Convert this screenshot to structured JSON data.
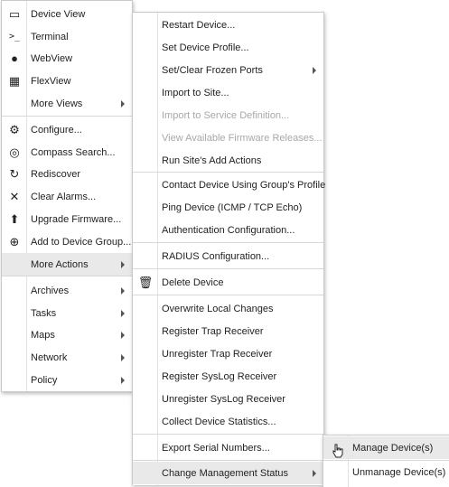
{
  "primary_menu": {
    "items": [
      {
        "label": "Device View",
        "icon": "display-icon",
        "glyph": "▭"
      },
      {
        "label": "Terminal",
        "icon": "terminal-icon",
        "glyph": ">_"
      },
      {
        "label": "WebView",
        "icon": "globe-icon",
        "glyph": "●"
      },
      {
        "label": "FlexView",
        "icon": "grid-icon",
        "glyph": "▦"
      },
      {
        "label": "More Views",
        "icon": "",
        "glyph": "",
        "submenu": true
      },
      {
        "label": "Configure...",
        "icon": "gear-icon",
        "glyph": "⚙"
      },
      {
        "label": "Compass Search...",
        "icon": "compass-icon",
        "glyph": "◎"
      },
      {
        "label": "Rediscover",
        "icon": "refresh-icon",
        "glyph": "↻"
      },
      {
        "label": "Clear Alarms...",
        "icon": "bell-off-icon",
        "glyph": "✕"
      },
      {
        "label": "Upgrade Firmware...",
        "icon": "upload-icon",
        "glyph": "⬆"
      },
      {
        "label": "Add to Device Group...",
        "icon": "add-circle-icon",
        "glyph": "⊕"
      },
      {
        "label": "More Actions",
        "icon": "",
        "glyph": "",
        "submenu": true,
        "highlighted": true
      },
      {
        "label": "Archives",
        "icon": "",
        "glyph": "",
        "submenu": true
      },
      {
        "label": "Tasks",
        "icon": "",
        "glyph": "",
        "submenu": true
      },
      {
        "label": "Maps",
        "icon": "",
        "glyph": "",
        "submenu": true
      },
      {
        "label": "Network",
        "icon": "",
        "glyph": "",
        "submenu": true
      },
      {
        "label": "Policy",
        "icon": "",
        "glyph": "",
        "submenu": true
      }
    ]
  },
  "more_actions_menu": {
    "items": [
      {
        "label": "Restart Device..."
      },
      {
        "label": "Set Device Profile..."
      },
      {
        "label": "Set/Clear Frozen Ports",
        "submenu": true
      },
      {
        "label": "Import to Site..."
      },
      {
        "label": "Import to Service Definition...",
        "disabled": true
      },
      {
        "label": "View Available Firmware Releases...",
        "disabled": true
      },
      {
        "label": "Run Site's Add Actions"
      },
      {
        "label": "Contact Device Using Group's Profile"
      },
      {
        "label": "Ping Device (ICMP / TCP Echo)"
      },
      {
        "label": "Authentication Configuration..."
      },
      {
        "label": "RADIUS Configuration..."
      },
      {
        "label": "Delete Device",
        "icon": "trash-icon",
        "glyph": "🗑"
      },
      {
        "label": "Overwrite Local Changes"
      },
      {
        "label": "Register Trap Receiver"
      },
      {
        "label": "Unregister Trap Receiver"
      },
      {
        "label": "Register SysLog Receiver"
      },
      {
        "label": "Unregister SysLog Receiver"
      },
      {
        "label": "Collect Device Statistics..."
      },
      {
        "label": "Export Serial Numbers..."
      },
      {
        "label": "Change Management Status",
        "submenu": true,
        "highlighted": true
      }
    ]
  },
  "management_status_menu": {
    "items": [
      {
        "label": "Manage Device(s)",
        "highlighted": true
      },
      {
        "label": "Unmanage Device(s)"
      }
    ]
  },
  "cursor": {
    "icon": "hand-pointer-icon"
  }
}
